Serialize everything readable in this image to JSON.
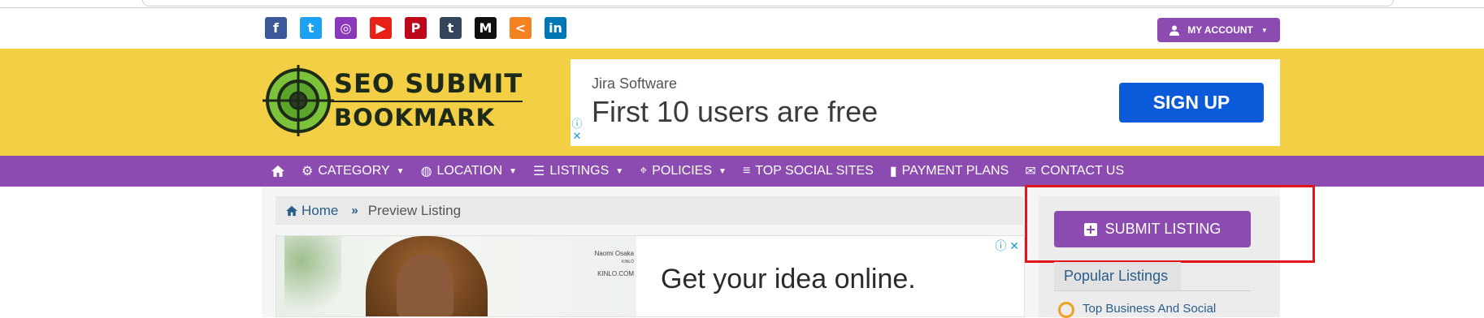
{
  "social_icons": [
    {
      "name": "facebook-icon",
      "glyph": "f",
      "color": "#3b5998"
    },
    {
      "name": "twitter-icon",
      "glyph": "t",
      "color": "#1da1f2"
    },
    {
      "name": "instagram-icon",
      "glyph": "◎",
      "color": "#8a3ab9"
    },
    {
      "name": "youtube-icon",
      "glyph": "▶",
      "color": "#e62117"
    },
    {
      "name": "pinterest-icon",
      "glyph": "P",
      "color": "#bd081c"
    },
    {
      "name": "tumblr-icon",
      "glyph": "t",
      "color": "#35465c"
    },
    {
      "name": "medium-icon",
      "glyph": "M",
      "color": "#12100e"
    },
    {
      "name": "share-icon",
      "glyph": "<",
      "color": "#f58220"
    },
    {
      "name": "linkedin-icon",
      "glyph": "in",
      "color": "#0077b5"
    }
  ],
  "account": {
    "label": "MY ACCOUNT"
  },
  "logo": {
    "line1": "SEO SUBMIT",
    "line2": "BOOKMARK"
  },
  "top_ad": {
    "brand": "Jira Software",
    "headline": "First 10 users are free",
    "cta": "SIGN UP"
  },
  "nav": {
    "items": [
      {
        "label": "CATEGORY",
        "icon": "cogs-icon",
        "dropdown": true
      },
      {
        "label": "LOCATION",
        "icon": "globe-icon",
        "dropdown": true
      },
      {
        "label": "LISTINGS",
        "icon": "list-icon",
        "dropdown": true
      },
      {
        "label": "POLICIES",
        "icon": "crosshair-icon",
        "dropdown": true
      },
      {
        "label": "TOP SOCIAL SITES",
        "icon": "align-left-icon",
        "dropdown": false
      },
      {
        "label": "PAYMENT PLANS",
        "icon": "receipt-icon",
        "dropdown": false
      },
      {
        "label": "CONTACT US",
        "icon": "envelope-icon",
        "dropdown": false
      }
    ]
  },
  "breadcrumb": {
    "home": "Home",
    "current": "Preview Listing"
  },
  "main_ad": {
    "tag_name": "Naomi Osaka",
    "tag_brand": "KINLŌ",
    "tag_url": "KINLO.COM",
    "headline": "Get your idea online."
  },
  "sidebar": {
    "submit_label": "SUBMIT LISTING",
    "popular_title": "Popular Listings",
    "popular_items": [
      "Top Business And Social"
    ]
  },
  "colors": {
    "purple": "#8b4bb0",
    "yellow": "#f2cf44",
    "link_blue": "#2a5c8a",
    "highlight_red": "#e0161b"
  }
}
